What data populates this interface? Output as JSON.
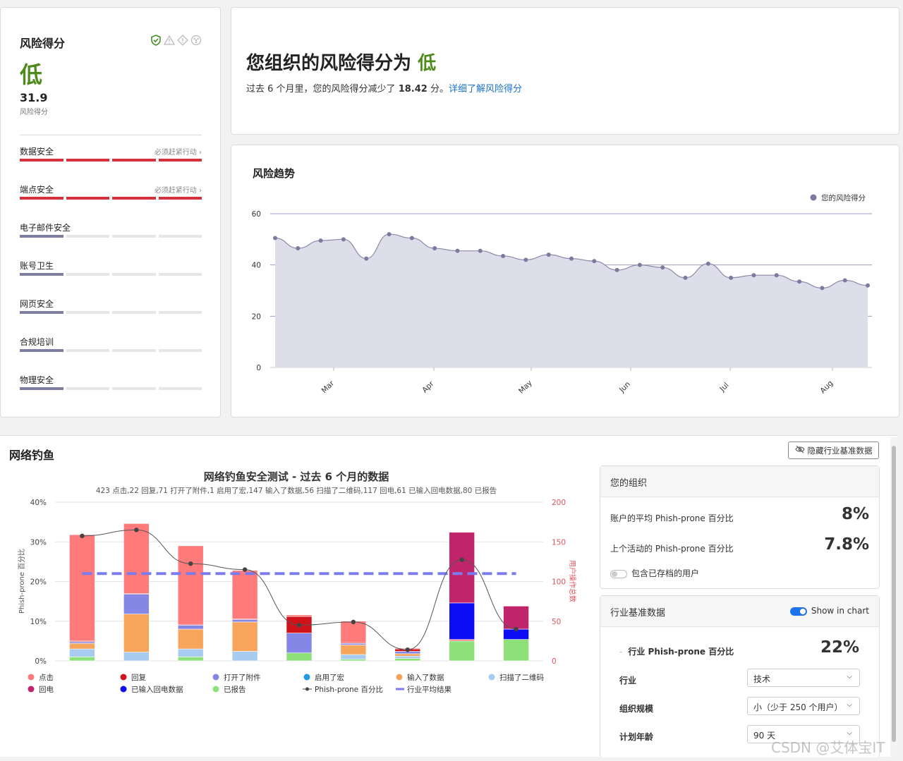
{
  "risk_card": {
    "title": "风险得分",
    "level": "低",
    "score": "31.9",
    "score_label": "风险得分",
    "categories": [
      {
        "name": "数据安全",
        "action": "必须赶紧行动 ›",
        "filled": 4,
        "color": "#d7313d"
      },
      {
        "name": "端点安全",
        "action": "必须赶紧行动 ›",
        "filled": 4,
        "color": "#d7313d"
      },
      {
        "name": "电子邮件安全",
        "action": "",
        "filled": 1,
        "color": "#7e7fa0"
      },
      {
        "name": "账号卫生",
        "action": "",
        "filled": 1,
        "color": "#7e7fa0"
      },
      {
        "name": "网页安全",
        "action": "",
        "filled": 1,
        "color": "#7e7fa0"
      },
      {
        "name": "合规培训",
        "action": "",
        "filled": 1,
        "color": "#7e7fa0"
      },
      {
        "name": "物理安全",
        "action": "",
        "filled": 1,
        "color": "#7e7fa0"
      }
    ]
  },
  "score_card": {
    "title_prefix": "您组织的风险得分为",
    "title_level": "低",
    "desc_prefix": "过去 6 个月里，您的风险得分减少了",
    "desc_value": "18.42",
    "desc_suffix": "分。",
    "link": "详细了解风险得分"
  },
  "trend": {
    "title": "风险趋势",
    "legend": "您的风险得分",
    "chart_data": {
      "type": "area",
      "yticks": [
        "0",
        "20",
        "40",
        "60"
      ],
      "ylim": [
        0,
        60
      ],
      "xticks": [
        "Mar",
        "Apr",
        "May",
        "Jun",
        "Jul",
        "Aug"
      ],
      "series": [
        {
          "name": "您的风险得分",
          "values": [
            50.5,
            46.5,
            49.5,
            50,
            42.5,
            52,
            50.5,
            46.5,
            45.5,
            45.5,
            43.5,
            42,
            44,
            42.5,
            41.5,
            38,
            40,
            39,
            35,
            40.5,
            35,
            36,
            36,
            33.5,
            31,
            34,
            32
          ]
        }
      ]
    }
  },
  "phishing": {
    "title": "网络钓鱼",
    "hide_button": "隐藏行业基准数据",
    "chart_title": "网络钓鱼安全测试 - 过去 6 个月的数据",
    "chart_subtitle": "423 点击,22 回复,71 打开了附件,1 启用了宏,147 输入了数据,56 扫描了二维码,117 回电,61 已输入回电数据,80 已报告",
    "y_left_label": "Phish-prone 百分比",
    "y_right_label": "用户操作总数",
    "y_left_ticks": [
      "0%",
      "10%",
      "20%",
      "30%",
      "40%"
    ],
    "y_right_ticks": [
      "0",
      "50",
      "100",
      "150",
      "200"
    ],
    "chart_data": {
      "type": "bar",
      "stack_order": [
        "已报告",
        "扫描了二维码",
        "输入了数据",
        "启用了宏",
        "打开了附件",
        "回复",
        "点击",
        "已输入回电数据",
        "回电"
      ],
      "colors": {
        "点击": "#ff7b7b",
        "回复": "#d0131a",
        "打开了附件": "#8487e6",
        "启用了宏": "#1f9bea",
        "输入了数据": "#f7a55b",
        "扫描了二维码": "#a8cbf0",
        "回电": "#c0246a",
        "已输入回电数据": "#0c0cf5",
        "已报告": "#8de07a"
      },
      "bars": [
        {
          "已报告": 5,
          "扫描了二维码": 10,
          "输入了数据": 7,
          "打开了附件": 2,
          "回复": 1,
          "点击": 134
        },
        {
          "扫描了二维码": 11,
          "输入了数据": 48,
          "打开了附件": 25,
          "回复": 1,
          "点击": 88
        },
        {
          "已报告": 5,
          "扫描了二维码": 10,
          "输入了数据": 25,
          "打开了附件": 5,
          "回复": 1,
          "点击": 99
        },
        {
          "扫描了二维码": 12,
          "输入了数据": 37,
          "打开了附件": 3,
          "回复": 1,
          "点击": 61
        },
        {
          "已报告": 10,
          "打开了附件": 25,
          "回复": 21,
          "点击": 2
        },
        {
          "已报告": 2,
          "扫描了二维码": 6,
          "输入了数据": 12,
          "打开了附件": 2,
          "回复": 1,
          "点击": 27
        },
        {
          "已报告": 3,
          "扫描了二维码": 3,
          "输入了数据": 3,
          "打开了附件": 3,
          "回复": 3,
          "点击": 1
        },
        {
          "已报告": 25,
          "已输入回电数据": 46,
          "回电": 89,
          "点击": 2
        },
        {
          "已报告": 27,
          "已输入回电数据": 13,
          "回电": 29
        }
      ],
      "line": {
        "name": "Phish-prone 百分比",
        "values": [
          31.5,
          33,
          24.5,
          23,
          9,
          9.8,
          2.8,
          25.5,
          8
        ]
      },
      "benchmark": {
        "name": "行业平均结果",
        "value": 22
      }
    },
    "legend": [
      {
        "label": "点击",
        "color": "#ff7b7b",
        "kind": "dot"
      },
      {
        "label": "回复",
        "color": "#d0131a",
        "kind": "dot"
      },
      {
        "label": "打开了附件",
        "color": "#8487e6",
        "kind": "dot"
      },
      {
        "label": "启用了宏",
        "color": "#1f9bea",
        "kind": "dot"
      },
      {
        "label": "输入了数据",
        "color": "#f7a55b",
        "kind": "dot"
      },
      {
        "label": "扫描了二维码",
        "color": "#a8cbf0",
        "kind": "dot"
      },
      {
        "label": "回电",
        "color": "#c0246a",
        "kind": "dot"
      },
      {
        "label": "已输入回电数据",
        "color": "#0c0cf5",
        "kind": "dot"
      },
      {
        "label": "已报告",
        "color": "#8de07a",
        "kind": "dot"
      },
      {
        "label": "Phish-prone 百分比",
        "color": "#444444",
        "kind": "line"
      },
      {
        "label": "行业平均结果",
        "color": "#7b7bf0",
        "kind": "dash"
      }
    ]
  },
  "org_panel": {
    "title": "您的组织",
    "avg_label": "账户的平均 Phish-prone 百分比",
    "avg_value": "8%",
    "last_label": "上个活动的 Phish-prone 百分比",
    "last_value": "7.8%",
    "toggle_label": "包含已存档的用户"
  },
  "bench_panel": {
    "title": "行业基准数据",
    "toggle_label": "Show in chart",
    "industry_pct_label": "行业 Phish-prone 百分比",
    "industry_pct_value": "22%",
    "industry_label": "行业",
    "industry_value": "技术",
    "size_label": "组织规模",
    "size_value": "小（少于 250 个用户）",
    "age_label": "计划年龄",
    "age_value": "90 天"
  },
  "watermark": "CSDN @艾体宝IT"
}
